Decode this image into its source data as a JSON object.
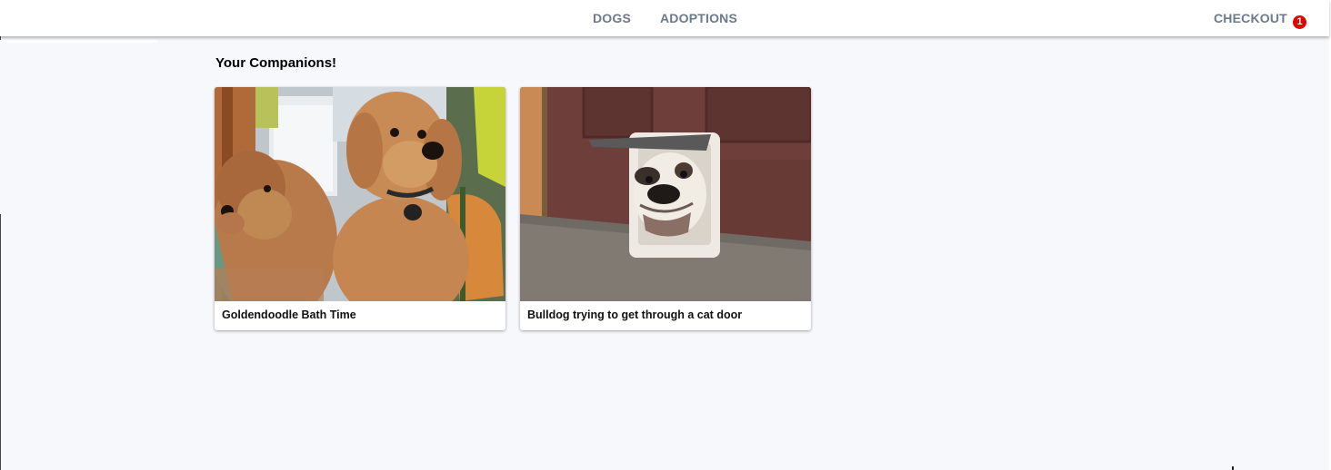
{
  "nav": {
    "links": [
      {
        "label": "DOGS"
      },
      {
        "label": "ADOPTIONS"
      }
    ],
    "checkout_label": "CHECKOUT",
    "cart_count": "1"
  },
  "colors": {
    "nav_text": "#6b7a8c",
    "badge": "#e60000",
    "page_bg": "#f7f8fc"
  },
  "main": {
    "heading": "Your Companions!",
    "cards": [
      {
        "caption": "Goldendoodle Bath Time",
        "image": "goldendoodles-photo"
      },
      {
        "caption": "Bulldog trying to get through a cat door",
        "image": "bulldog-cat-door-photo"
      }
    ]
  }
}
